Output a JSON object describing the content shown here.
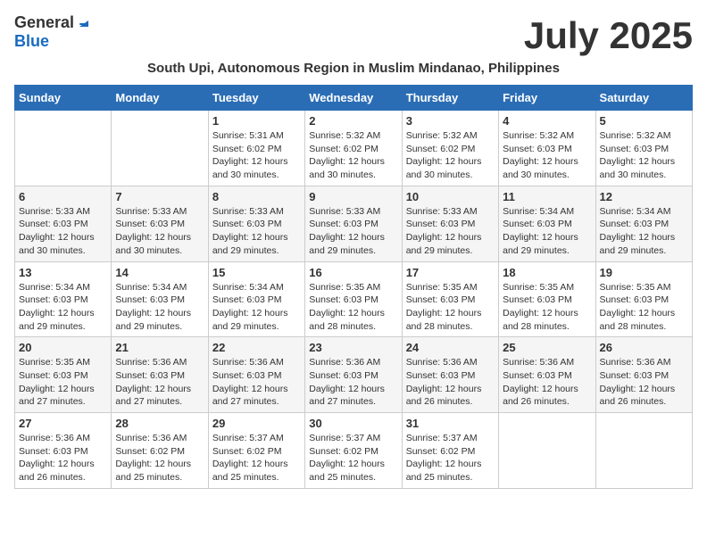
{
  "logo": {
    "general": "General",
    "blue": "Blue"
  },
  "title": "July 2025",
  "subtitle": "South Upi, Autonomous Region in Muslim Mindanao, Philippines",
  "weekdays": [
    "Sunday",
    "Monday",
    "Tuesday",
    "Wednesday",
    "Thursday",
    "Friday",
    "Saturday"
  ],
  "weeks": [
    [
      {
        "day": "",
        "detail": ""
      },
      {
        "day": "",
        "detail": ""
      },
      {
        "day": "1",
        "detail": "Sunrise: 5:31 AM\nSunset: 6:02 PM\nDaylight: 12 hours and 30 minutes."
      },
      {
        "day": "2",
        "detail": "Sunrise: 5:32 AM\nSunset: 6:02 PM\nDaylight: 12 hours and 30 minutes."
      },
      {
        "day": "3",
        "detail": "Sunrise: 5:32 AM\nSunset: 6:02 PM\nDaylight: 12 hours and 30 minutes."
      },
      {
        "day": "4",
        "detail": "Sunrise: 5:32 AM\nSunset: 6:03 PM\nDaylight: 12 hours and 30 minutes."
      },
      {
        "day": "5",
        "detail": "Sunrise: 5:32 AM\nSunset: 6:03 PM\nDaylight: 12 hours and 30 minutes."
      }
    ],
    [
      {
        "day": "6",
        "detail": "Sunrise: 5:33 AM\nSunset: 6:03 PM\nDaylight: 12 hours and 30 minutes."
      },
      {
        "day": "7",
        "detail": "Sunrise: 5:33 AM\nSunset: 6:03 PM\nDaylight: 12 hours and 30 minutes."
      },
      {
        "day": "8",
        "detail": "Sunrise: 5:33 AM\nSunset: 6:03 PM\nDaylight: 12 hours and 29 minutes."
      },
      {
        "day": "9",
        "detail": "Sunrise: 5:33 AM\nSunset: 6:03 PM\nDaylight: 12 hours and 29 minutes."
      },
      {
        "day": "10",
        "detail": "Sunrise: 5:33 AM\nSunset: 6:03 PM\nDaylight: 12 hours and 29 minutes."
      },
      {
        "day": "11",
        "detail": "Sunrise: 5:34 AM\nSunset: 6:03 PM\nDaylight: 12 hours and 29 minutes."
      },
      {
        "day": "12",
        "detail": "Sunrise: 5:34 AM\nSunset: 6:03 PM\nDaylight: 12 hours and 29 minutes."
      }
    ],
    [
      {
        "day": "13",
        "detail": "Sunrise: 5:34 AM\nSunset: 6:03 PM\nDaylight: 12 hours and 29 minutes."
      },
      {
        "day": "14",
        "detail": "Sunrise: 5:34 AM\nSunset: 6:03 PM\nDaylight: 12 hours and 29 minutes."
      },
      {
        "day": "15",
        "detail": "Sunrise: 5:34 AM\nSunset: 6:03 PM\nDaylight: 12 hours and 29 minutes."
      },
      {
        "day": "16",
        "detail": "Sunrise: 5:35 AM\nSunset: 6:03 PM\nDaylight: 12 hours and 28 minutes."
      },
      {
        "day": "17",
        "detail": "Sunrise: 5:35 AM\nSunset: 6:03 PM\nDaylight: 12 hours and 28 minutes."
      },
      {
        "day": "18",
        "detail": "Sunrise: 5:35 AM\nSunset: 6:03 PM\nDaylight: 12 hours and 28 minutes."
      },
      {
        "day": "19",
        "detail": "Sunrise: 5:35 AM\nSunset: 6:03 PM\nDaylight: 12 hours and 28 minutes."
      }
    ],
    [
      {
        "day": "20",
        "detail": "Sunrise: 5:35 AM\nSunset: 6:03 PM\nDaylight: 12 hours and 27 minutes."
      },
      {
        "day": "21",
        "detail": "Sunrise: 5:36 AM\nSunset: 6:03 PM\nDaylight: 12 hours and 27 minutes."
      },
      {
        "day": "22",
        "detail": "Sunrise: 5:36 AM\nSunset: 6:03 PM\nDaylight: 12 hours and 27 minutes."
      },
      {
        "day": "23",
        "detail": "Sunrise: 5:36 AM\nSunset: 6:03 PM\nDaylight: 12 hours and 27 minutes."
      },
      {
        "day": "24",
        "detail": "Sunrise: 5:36 AM\nSunset: 6:03 PM\nDaylight: 12 hours and 26 minutes."
      },
      {
        "day": "25",
        "detail": "Sunrise: 5:36 AM\nSunset: 6:03 PM\nDaylight: 12 hours and 26 minutes."
      },
      {
        "day": "26",
        "detail": "Sunrise: 5:36 AM\nSunset: 6:03 PM\nDaylight: 12 hours and 26 minutes."
      }
    ],
    [
      {
        "day": "27",
        "detail": "Sunrise: 5:36 AM\nSunset: 6:03 PM\nDaylight: 12 hours and 26 minutes."
      },
      {
        "day": "28",
        "detail": "Sunrise: 5:36 AM\nSunset: 6:02 PM\nDaylight: 12 hours and 25 minutes."
      },
      {
        "day": "29",
        "detail": "Sunrise: 5:37 AM\nSunset: 6:02 PM\nDaylight: 12 hours and 25 minutes."
      },
      {
        "day": "30",
        "detail": "Sunrise: 5:37 AM\nSunset: 6:02 PM\nDaylight: 12 hours and 25 minutes."
      },
      {
        "day": "31",
        "detail": "Sunrise: 5:37 AM\nSunset: 6:02 PM\nDaylight: 12 hours and 25 minutes."
      },
      {
        "day": "",
        "detail": ""
      },
      {
        "day": "",
        "detail": ""
      }
    ]
  ]
}
